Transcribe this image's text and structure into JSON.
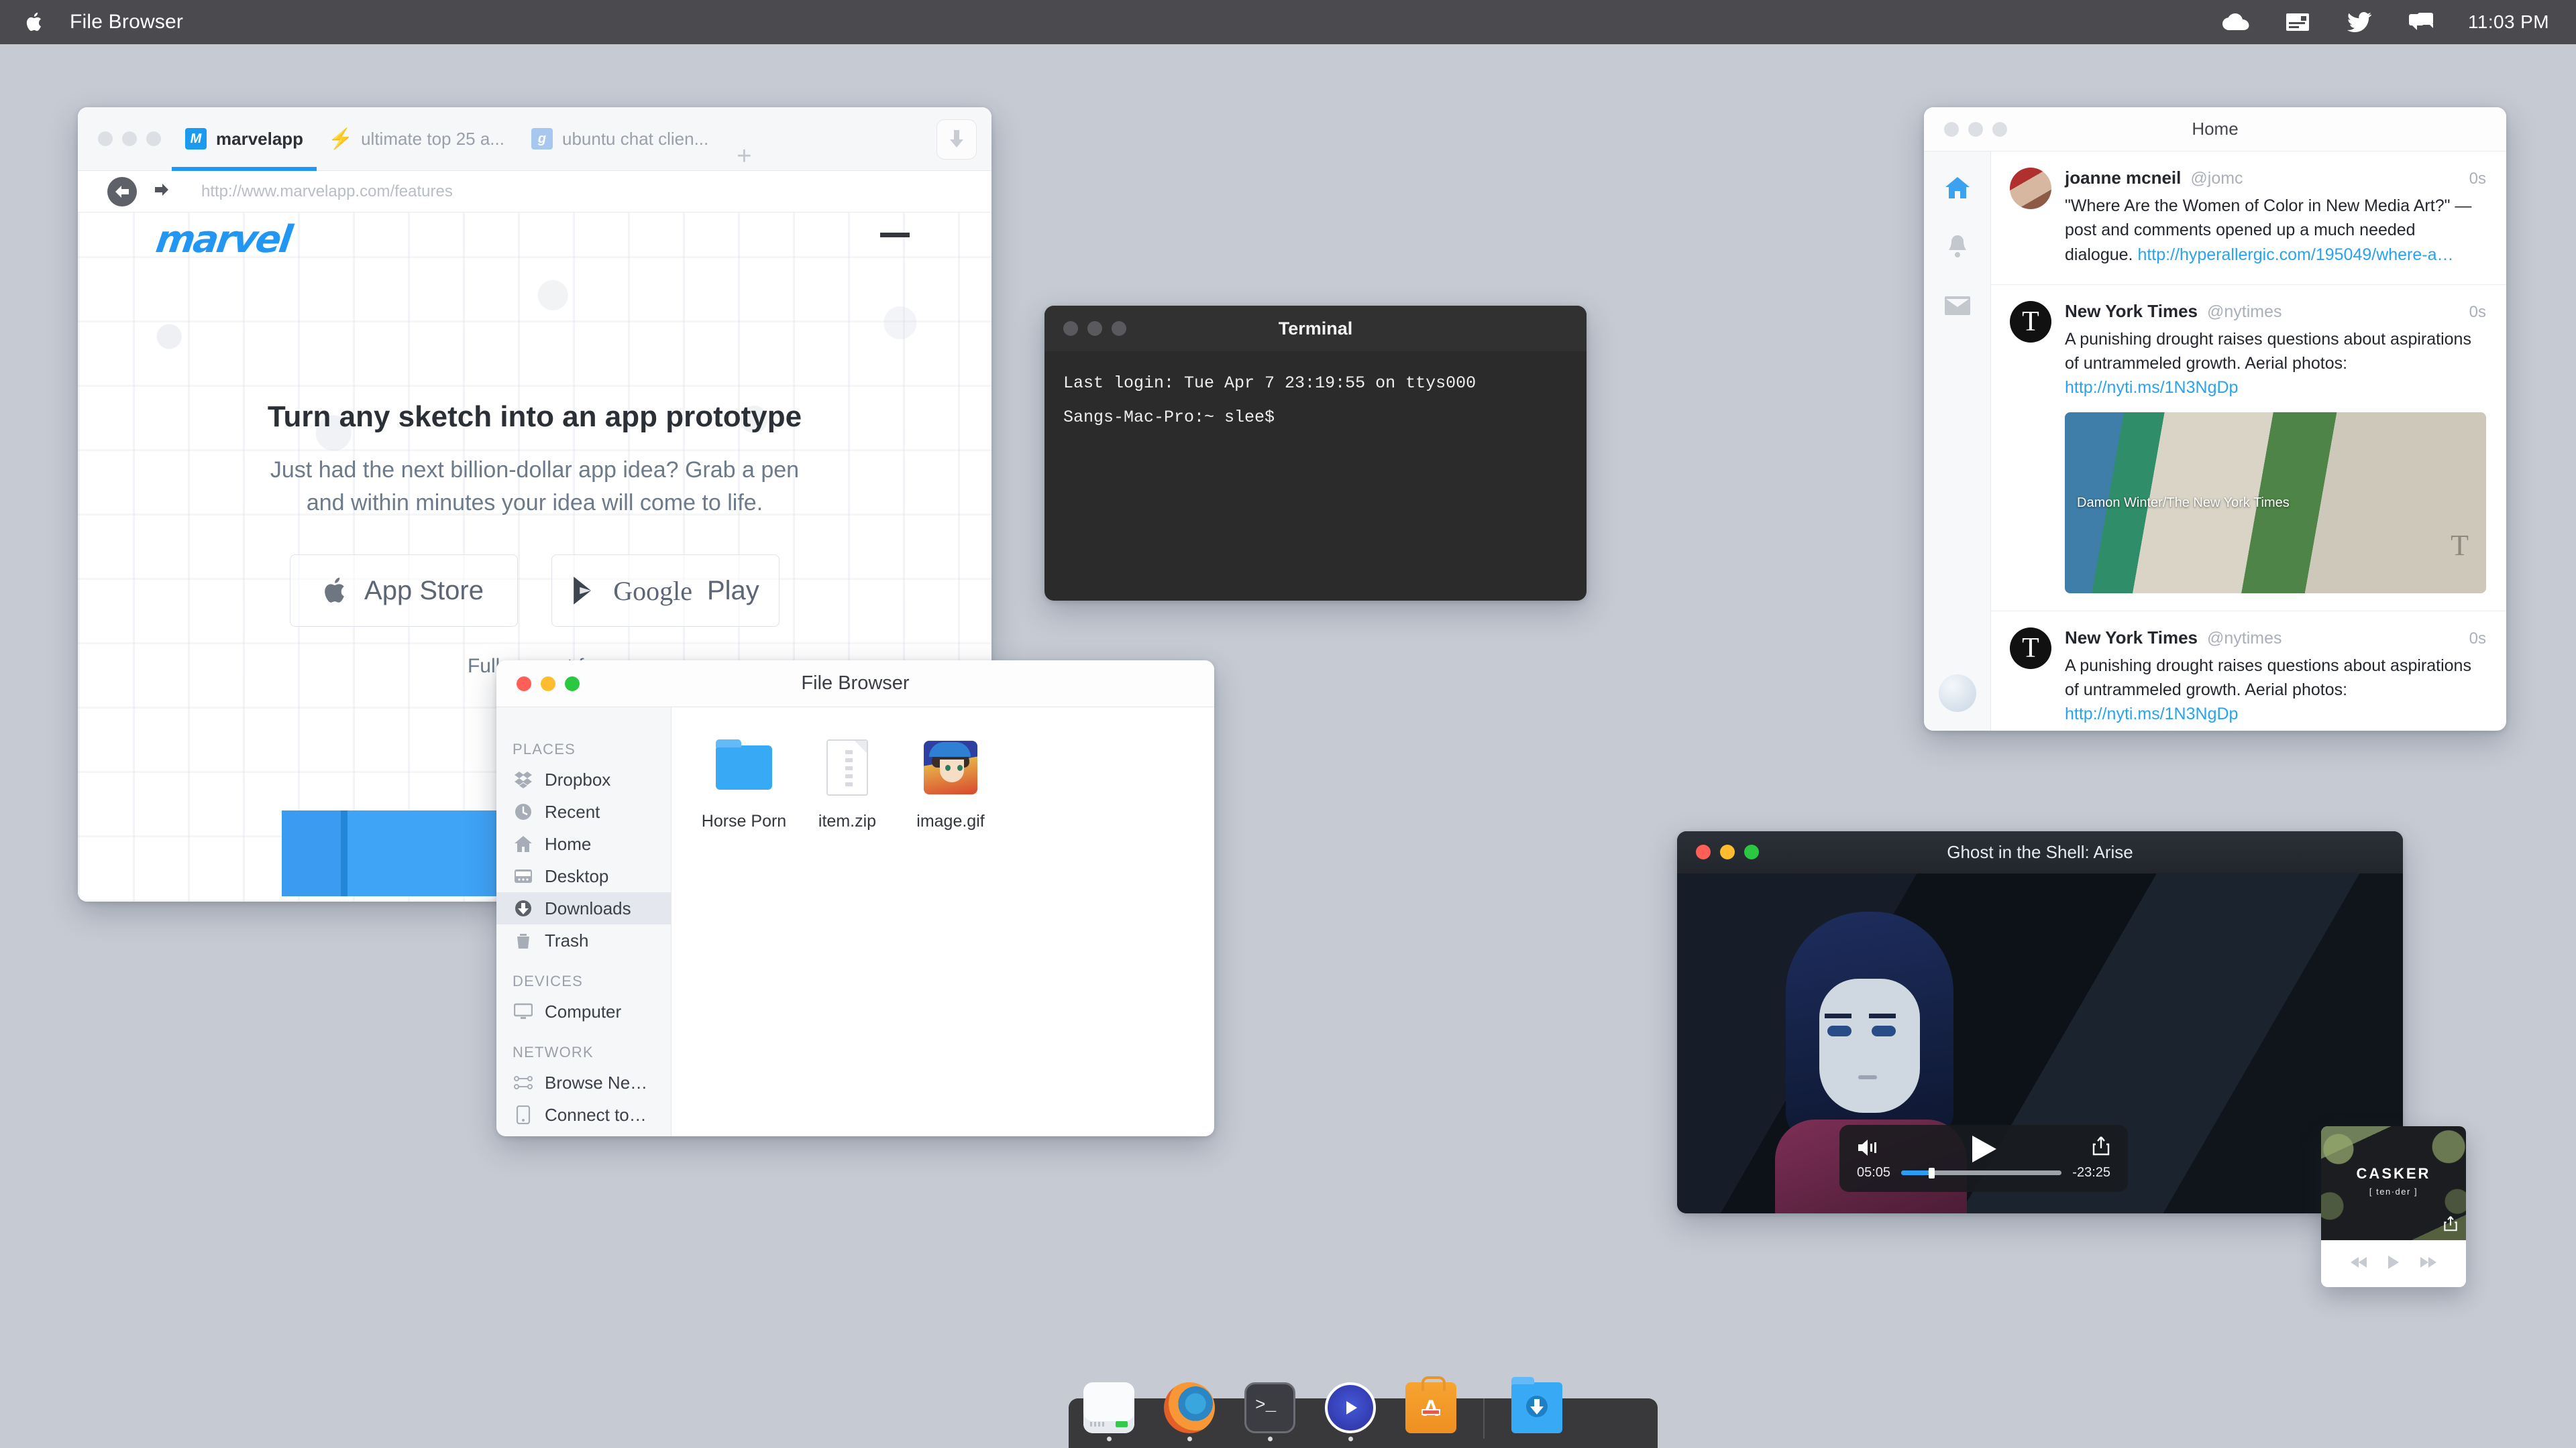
{
  "menubar": {
    "apple_icon": "apple-icon",
    "app_title": "File Browser",
    "icons": [
      "cloud-icon",
      "mail-icon",
      "twitter-icon",
      "chat-icon"
    ],
    "clock": "11:03 PM"
  },
  "browser": {
    "tabs": [
      {
        "label": "marvelapp",
        "favicon": "marvelapp-favicon",
        "active": true
      },
      {
        "label": "ultimate top 25 a...",
        "favicon": "bolt-favicon",
        "active": false
      },
      {
        "label": "ubuntu chat clien...",
        "favicon": "google-favicon",
        "active": false
      }
    ],
    "new_tab_label": "+",
    "download_icon": "download-arrow-icon",
    "url": "http://www.marvelapp.com/features",
    "page": {
      "logo": "marvel",
      "headline": "Turn any sketch into an app prototype",
      "subline_1": "Just had the next billion-dollar app idea? Grab a pen",
      "subline_2": "and within minutes your idea will come to life.",
      "app_store_label": "App Store",
      "google_label": "Google",
      "play_label": "Play",
      "footer_text": "Full support for"
    }
  },
  "terminal": {
    "title": "Terminal",
    "lines": [
      "Last login: Tue Apr  7 23:19:55 on ttys000",
      "Sangs-Mac-Pro:~ slee$"
    ]
  },
  "file_browser": {
    "title": "File Browser",
    "sidebar": {
      "groups": [
        {
          "label": "PLACES",
          "items": [
            {
              "label": "Dropbox",
              "icon": "dropbox-icon",
              "selected": false
            },
            {
              "label": "Recent",
              "icon": "clock-icon",
              "selected": false
            },
            {
              "label": "Home",
              "icon": "home-icon",
              "selected": false
            },
            {
              "label": "Desktop",
              "icon": "desktop-icon",
              "selected": false
            },
            {
              "label": "Downloads",
              "icon": "download-icon",
              "selected": true
            },
            {
              "label": "Trash",
              "icon": "trash-icon",
              "selected": false
            }
          ]
        },
        {
          "label": "DEVICES",
          "items": [
            {
              "label": "Computer",
              "icon": "monitor-icon",
              "selected": false
            }
          ]
        },
        {
          "label": "NETWORK",
          "items": [
            {
              "label": "Browse Ne…",
              "icon": "network-icon",
              "selected": false
            },
            {
              "label": "Connect to…",
              "icon": "server-icon",
              "selected": false
            }
          ]
        }
      ]
    },
    "files": [
      {
        "name": "Horse Porn",
        "type": "folder"
      },
      {
        "name": "item.zip",
        "type": "zip"
      },
      {
        "name": "image.gif",
        "type": "image"
      }
    ]
  },
  "twitter": {
    "title": "Home",
    "nav_icons": [
      "home-icon",
      "notifications-bell-icon",
      "messages-envelope-icon"
    ],
    "tweets": [
      {
        "name": "joanne mcneil",
        "handle": "@jomc",
        "time": "0s",
        "text": "\"Where Are the Women of Color in New Media Art?\" — post and comments opened up a much needed dialogue. ",
        "link": "http://hyperallergic.com/195049/where-a…",
        "has_photo": false
      },
      {
        "name": "New York Times",
        "handle": "@nytimes",
        "time": "0s",
        "text": "A punishing drought raises questions about aspirations of untrammeled growth. Aerial photos: ",
        "link": "http://nyti.ms/1N3NgDp",
        "has_photo": true,
        "photo_caption": "Damon Winter/The New York Times"
      },
      {
        "name": "New York Times",
        "handle": "@nytimes",
        "time": "0s",
        "text": "A punishing drought raises questions about aspirations of untrammeled growth. Aerial photos: ",
        "link": "http://nyti.ms/1N3NgDp",
        "has_photo": false
      }
    ]
  },
  "video": {
    "title": "Ghost in the Shell: Arise",
    "elapsed": "05:05",
    "remaining": "-23:25",
    "progress_percent": 17,
    "volume_icon": "volume-icon",
    "play_icon": "play-icon",
    "share_icon": "share-icon"
  },
  "music": {
    "album_title": "CASKER",
    "album_subtitle": "[ ten·der ]",
    "share_icon": "share-icon",
    "prev_icon": "previous-track-icon",
    "play_icon": "play-icon",
    "next_icon": "next-track-icon"
  },
  "dock": {
    "items": [
      {
        "name": "Finder",
        "icon": "finder-icon",
        "running": true
      },
      {
        "name": "Firefox",
        "icon": "firefox-icon",
        "running": true
      },
      {
        "name": "Terminal",
        "icon": "terminal-icon",
        "running": true
      },
      {
        "name": "Video Player",
        "icon": "video-player-icon",
        "running": true
      },
      {
        "name": "App Store",
        "icon": "app-store-icon",
        "running": false
      },
      {
        "name": "Downloads",
        "icon": "downloads-folder-icon",
        "running": false
      }
    ]
  },
  "colors": {
    "desktop": "#c5cad3",
    "menubar": "#4b4b4f",
    "accent_blue": "#2196f3",
    "link_blue": "#2aa3ef"
  }
}
